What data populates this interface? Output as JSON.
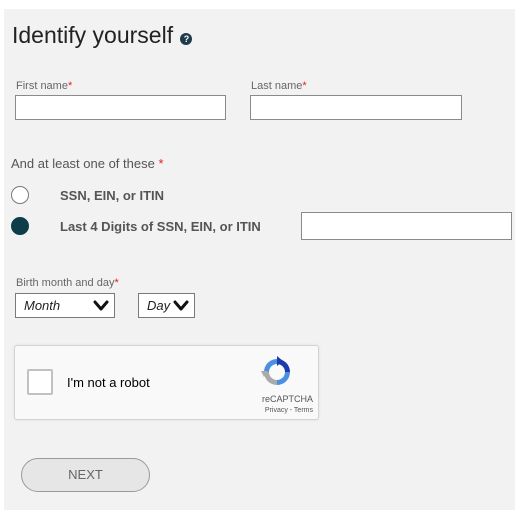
{
  "form": {
    "title": "Identify yourself",
    "help_icon": "question-circle-icon",
    "required_marker": "*",
    "first_name": {
      "label": "First name",
      "value": ""
    },
    "last_name": {
      "label": "Last name",
      "value": ""
    },
    "id_group_label": "And at least one of these",
    "id_options": [
      {
        "label": "SSN, EIN, or ITIN",
        "checked": false
      },
      {
        "label": "Last 4 Digits of SSN, EIN, or ITIN",
        "checked": true
      }
    ],
    "last4_value": "",
    "birth_label": "Birth month and day",
    "month_select": {
      "value": "Month"
    },
    "day_select": {
      "value": "Day"
    },
    "captcha": {
      "label": "I'm not a robot",
      "brand": "reCAPTCHA",
      "links": "Privacy - Terms",
      "checked": false
    },
    "next_label": "NEXT"
  },
  "colors": {
    "panel_bg": "#f2f2f2",
    "required": "#e02020",
    "radio_checked": "#0e3d4a"
  }
}
